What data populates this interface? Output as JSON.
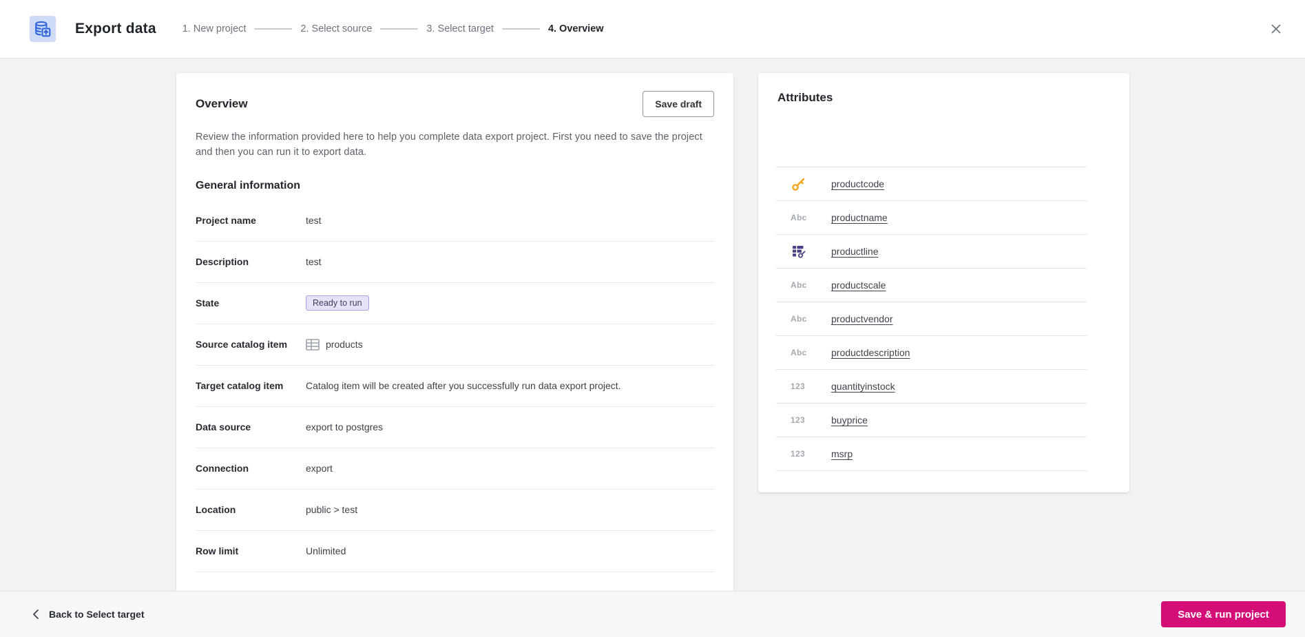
{
  "header": {
    "title": "Export data",
    "steps": [
      {
        "label": "1. New project",
        "active": false
      },
      {
        "label": "2. Select source",
        "active": false
      },
      {
        "label": "3. Select target",
        "active": false
      },
      {
        "label": "4. Overview",
        "active": true
      }
    ]
  },
  "overview": {
    "title": "Overview",
    "save_draft_label": "Save draft",
    "description": "Review the information provided here to help you complete data export project. First you need to save the project and then you can run it to export data.",
    "section_title": "General information",
    "rows": [
      {
        "label": "Project name",
        "value": "test",
        "type": "text"
      },
      {
        "label": "Description",
        "value": "test",
        "type": "text"
      },
      {
        "label": "State",
        "value": "Ready to run",
        "type": "badge"
      },
      {
        "label": "Source catalog item",
        "value": "products",
        "type": "table-item"
      },
      {
        "label": "Target catalog item",
        "value": "Catalog item will be created after you successfully run data export project.",
        "type": "text"
      },
      {
        "label": "Data source",
        "value": "export to postgres",
        "type": "text"
      },
      {
        "label": "Connection",
        "value": "export",
        "type": "text"
      },
      {
        "label": "Location",
        "value": "public > test",
        "type": "text"
      },
      {
        "label": "Row limit",
        "value": "Unlimited",
        "type": "text"
      }
    ]
  },
  "attributes": {
    "title": "Attributes",
    "type_labels": {
      "string": "Abc",
      "number": "123"
    },
    "items": [
      {
        "name": "productcode",
        "type": "primary-key"
      },
      {
        "name": "productname",
        "type": "string"
      },
      {
        "name": "productline",
        "type": "foreign-key"
      },
      {
        "name": "productscale",
        "type": "string"
      },
      {
        "name": "productvendor",
        "type": "string"
      },
      {
        "name": "productdescription",
        "type": "string"
      },
      {
        "name": "quantityinstock",
        "type": "number"
      },
      {
        "name": "buyprice",
        "type": "number"
      },
      {
        "name": "msrp",
        "type": "number"
      }
    ]
  },
  "footer": {
    "back_label": "Back to Select target",
    "save_run_label": "Save & run project"
  },
  "colors": {
    "accent_pink": "#d40e76",
    "accent_blue": "#2d64dd",
    "icon_bg_blue": "#cedbf7",
    "badge_bg": "#e7e2f7",
    "badge_border": "#ab9fe0",
    "key_orange": "#f2a41c",
    "fk_purple": "#4a3e85",
    "page_bg": "#f1f2f4"
  }
}
